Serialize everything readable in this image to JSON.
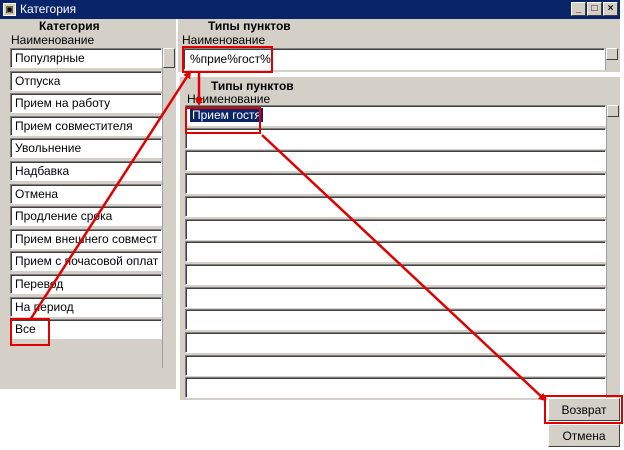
{
  "window": {
    "title": "Категория",
    "app_icon_glyph": "▣"
  },
  "category_panel": {
    "header": "Категория",
    "column_label": "Наименование",
    "items": [
      "Популярные",
      "Отпуска",
      "Прием на работу",
      "Прием совместителя",
      "Увольнение",
      "Надбавка",
      "Отмена",
      "Продление срока",
      "Прием внешнего совмест",
      "Прием с почасовой оплат",
      "Перевод",
      "На период",
      "Все"
    ]
  },
  "types_panel": {
    "header": "Типы пунктов",
    "column_label": "Наименование",
    "search_value": "%прие%гост%"
  },
  "results_panel": {
    "header": "Типы пунктов",
    "column_label": "Наименование",
    "selected_item": "Прием гостя"
  },
  "buttons": {
    "return_label": "Возврат",
    "cancel_label": "Отмена"
  },
  "colors": {
    "title_bar": "#0a246a",
    "panel": "#d4d0c8",
    "highlight": "#e00000",
    "selection": "#0a246a"
  }
}
